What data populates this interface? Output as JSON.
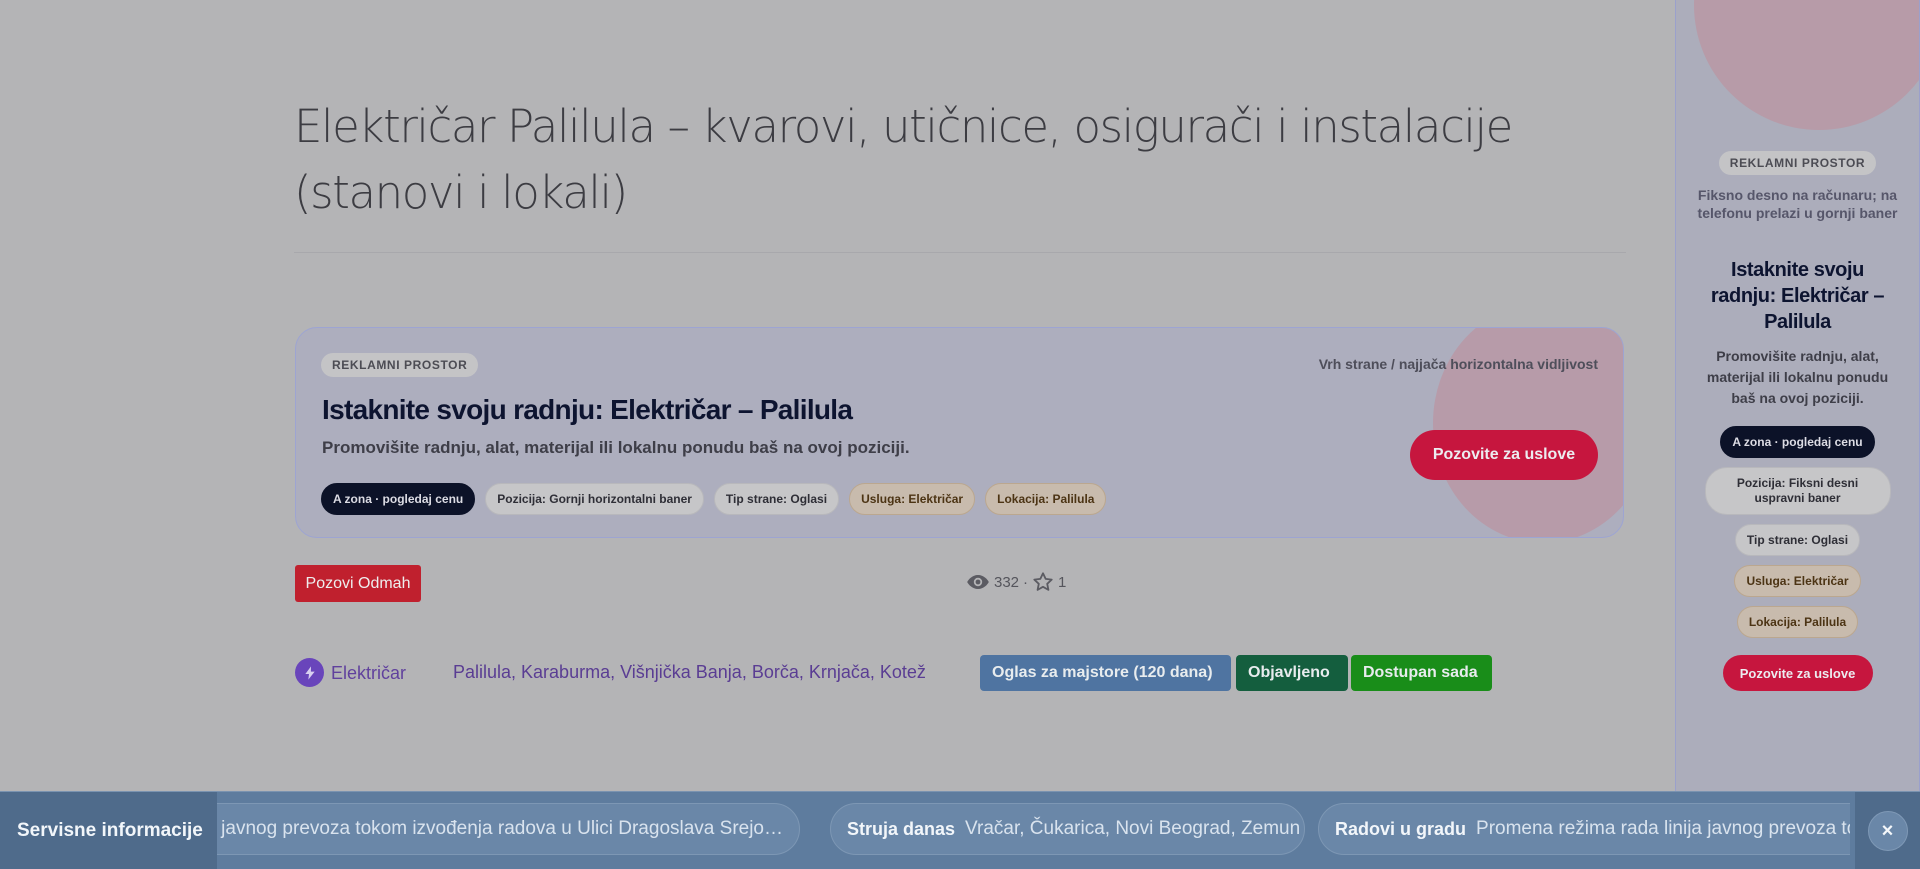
{
  "page": {
    "title": "Električar Palilula – kvarovi, utičnice, osigurači i instalacije (stanovi i lokali)"
  },
  "top_ad": {
    "badge": "REKLAMNI PROSTOR",
    "position_note": "Vrh strane / najjača horizontalna vidljivost",
    "title": "Istaknite svoju radnju: Električar – Palilula",
    "subtitle": "Promovišite radnju, alat, materijal ili lokalnu ponudu baš na ovoj poziciji.",
    "chips": [
      "A zona · pogledaj cenu",
      "Pozicija: Gornji horizontalni baner",
      "Tip strane: Oglasi",
      "Usluga: Električar",
      "Lokacija: Palilula"
    ],
    "cta": "Pozovite za uslove"
  },
  "listing": {
    "call_button": "Pozovi Odmah",
    "views": "332",
    "separator": "·",
    "favorites": "1",
    "category": "Električar",
    "locations": "Palilula, Karaburma, Višnjička Banja, Borča, Krnjača, Kotež",
    "tags": [
      "Oglas za majstore (120 dana)",
      "Objavljeno",
      "Dostupan sada"
    ]
  },
  "side_ad": {
    "badge": "REKLAMNI PROSTOR",
    "note": "Fiksno desno na računaru; na telefonu prelazi u gornji baner",
    "title": "Istaknite svoju radnju: Električar – Palilula",
    "subtitle": "Promovišite radnju, alat, materijal ili lokalnu ponudu baš na ovoj poziciji.",
    "chips": [
      "A zona · pogledaj cenu",
      "Pozicija: Fiksni desni uspravni baner",
      "Tip strane: Oglasi",
      "Usluga: Električar",
      "Lokacija: Palilula"
    ],
    "cta": "Pozovite za uslove"
  },
  "ticker": {
    "label": "Servisne informacije",
    "items": [
      {
        "title": "",
        "text": "ja javnog prevoza tokom izvođenja radova u Ulici Dragoslava Srejo…"
      },
      {
        "title": "Struja danas",
        "text": "Vračar, Čukarica, Novi Beograd, Zemun"
      },
      {
        "title": "Radovi u gradu",
        "text": "Promena režima rada linija javnog prevoza to"
      }
    ],
    "close_symbol": "×"
  },
  "colors": {
    "overlay_bg": "#b4b4b6",
    "cta_red": "#c6163e",
    "call_red": "#c0202e",
    "category_purple": "#6945bb",
    "tag_blue": "#4f74a1",
    "tag_green_dark": "#145e3e",
    "tag_green": "#198d19",
    "ticker_bg": "#5e7c9e"
  },
  "icons": {
    "views": "eye-icon",
    "favorites": "star-outline-icon",
    "category": "lightning-bolt-icon",
    "close": "close-icon"
  }
}
